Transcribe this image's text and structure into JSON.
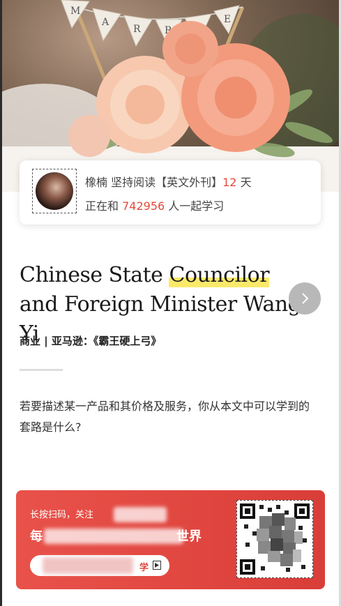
{
  "hero": {
    "banner_letters": [
      "M",
      "A",
      "R",
      "R",
      "I",
      "E",
      "D"
    ]
  },
  "reader": {
    "name": "橡楠",
    "prefix": "坚持阅读【英文外刊】",
    "days": "12",
    "days_unit": "天",
    "studying_prefix": "正在和",
    "count": "742956",
    "studying_suffix": "人一起学习"
  },
  "article": {
    "title_part1": "Chinese State ",
    "title_highlight": "Councilor",
    "title_part2": " and Foreign Minister Wang Yi",
    "subtitle": "商业 | 亚马逊：《霸王硬上弓》",
    "prompt": "若要描述某一产品和其价格及服务，你从本文中可以学到的套路是什么?"
  },
  "promo": {
    "line1": "长按扫码，关注",
    "line2_start": "每",
    "line2_end": "世界",
    "button_label": "学"
  },
  "colors": {
    "accent_red": "#e24a3b",
    "promo_bg": "#e0463f",
    "highlight": "#fbe96a",
    "next_button": "#b8b8b8"
  },
  "icons": {
    "next": "chevron-right-icon",
    "promo_button": "play-icon"
  }
}
